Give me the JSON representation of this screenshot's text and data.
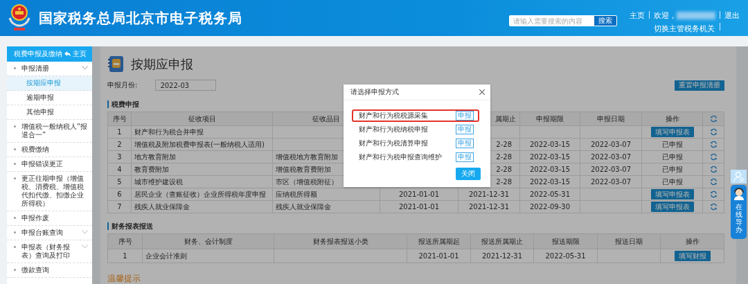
{
  "header": {
    "title": "国家税务总局北京市电子税务局",
    "search": {
      "placeholder": "请输入需要搜索的内容",
      "button": "搜索"
    },
    "home_link": "主页",
    "welcome": "欢迎，",
    "switch_link": "切换主管税务机关",
    "logout_link": "退出"
  },
  "sidebar": {
    "title": "税费申报及缴纳",
    "home_link": "主页",
    "items": [
      {
        "label": "申报清册",
        "selected": false,
        "expanded": true,
        "children": [
          {
            "label": "按期应申报",
            "selected": true
          },
          {
            "label": "逾期申报",
            "selected": false
          },
          {
            "label": "其他申报",
            "selected": false
          }
        ]
      },
      {
        "label": "增值税一般纳税人“报退合一”",
        "selected": false
      },
      {
        "label": "税费缴纳",
        "selected": false
      },
      {
        "label": "申报错误更正",
        "selected": false
      },
      {
        "label": "更正往期申报（增值税、消费税、增值税代扣代缴、扣缴企业所得税）",
        "selected": false
      },
      {
        "label": "申报作废",
        "selected": false
      },
      {
        "label": "申报台账查询",
        "selected": false,
        "expanded": false
      },
      {
        "label": "申报表（财务报表）查询及打印",
        "selected": false,
        "expanded": false
      },
      {
        "label": "缴款查询",
        "selected": false
      }
    ]
  },
  "page": {
    "title": "按期应申报",
    "month": {
      "label": "申报月份:",
      "value": "2022-03"
    },
    "reset_button": "重置申报清册",
    "tax_section": {
      "title": "税费申报",
      "columns": [
        {
          "kind": "text",
          "label": "序号"
        },
        {
          "kind": "text",
          "label": "征收项目"
        },
        {
          "kind": "text",
          "label": "征收品目"
        },
        null,
        {
          "kind": "text",
          "label": "属期止",
          "clipped": true
        },
        {
          "kind": "text",
          "label": "申报期限"
        },
        {
          "kind": "text",
          "label": "申报日期"
        },
        {
          "kind": "text",
          "label": "操作"
        },
        {
          "kind": "icon"
        }
      ],
      "rows": [
        {
          "no": "1",
          "item": "财产和行为税合并申报",
          "action": {
            "kind": "button",
            "label": "填写申报表"
          }
        },
        {
          "no": "2",
          "item": "增值税及附加税费申报表(一般纳税人适用)",
          "end": "2-28",
          "end_clipped": true,
          "deadline": "2022-03-15",
          "date": "2022-03-07",
          "action": {
            "kind": "status",
            "label": "已申报"
          }
        },
        {
          "no": "3",
          "item": "地方教育附加",
          "category": "增值税地方教育附加",
          "end": "2-28",
          "end_clipped": true,
          "deadline": "2022-03-15",
          "date": "2022-03-07",
          "action": {
            "kind": "status",
            "label": "已申报"
          }
        },
        {
          "no": "4",
          "item": "教育费附加",
          "category": "增值税教育费附加",
          "end": "2-28",
          "end_clipped": true,
          "deadline": "2022-03-15",
          "date": "2022-03-07",
          "action": {
            "kind": "status",
            "label": "已申报"
          }
        },
        {
          "no": "5",
          "item": "城市维护建设税",
          "category": "市区（增值税附征）",
          "end": "2-28",
          "end_clipped": true,
          "deadline": "2022-03-15",
          "date": "2022-03-07",
          "action": {
            "kind": "status",
            "label": "已申报"
          }
        },
        {
          "no": "6",
          "item": "居民企业（查账征收）企业所得税年度申报",
          "category": "应纳税所得额",
          "start": "2021-01-01",
          "end": "2021-12-31",
          "deadline": "2022-05-31",
          "action": {
            "kind": "button",
            "label": "填写申报表"
          }
        },
        {
          "no": "7",
          "item": "残疾人就业保障金",
          "category": "残疾人就业保障金",
          "start": "2021-01-01",
          "end": "2021-12-31",
          "deadline": "2022-09-30",
          "action": {
            "kind": "button",
            "label": "填写申报表"
          }
        }
      ]
    },
    "finance_section": {
      "title": "财务报表报送",
      "columns": [
        "序号",
        "财务、会计制度",
        "财务报表报送小类",
        "报送所属期起",
        "报送所属期止",
        "报送期限",
        "报送日期",
        "操作"
      ],
      "rows": [
        {
          "no": "1",
          "system": "企业会计准则",
          "start": "2021-01-01",
          "end": "2021-12-31",
          "deadline": "2022-05-31",
          "action": {
            "kind": "button",
            "label": "填写财报"
          }
        }
      ]
    },
    "tip_title": "温馨提示"
  },
  "modal": {
    "title": "请选择申报方式",
    "options": [
      {
        "label": "财产和行为税税源采集",
        "button": "申报",
        "highlighted": true
      },
      {
        "label": "财产和行为税纳税申报",
        "button": "申报",
        "highlighted": false
      },
      {
        "label": "财产和行为税清算申报",
        "button": "申报",
        "highlighted": false
      },
      {
        "label": "财产和行为税申报查询维护",
        "button": "申报",
        "highlighted": false
      }
    ],
    "close_button": "关闭"
  },
  "guide_widget": {
    "label": "在线导办"
  }
}
